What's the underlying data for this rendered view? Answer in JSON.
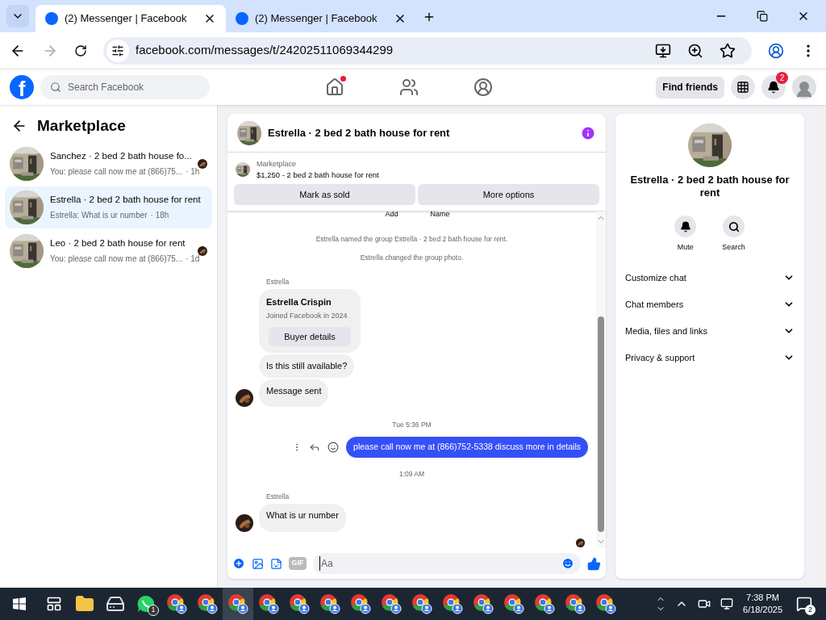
{
  "browser": {
    "tabs": [
      {
        "title": "(2) Messenger | Facebook",
        "selected": true
      },
      {
        "title": "(2) Messenger | Facebook",
        "selected": false
      }
    ],
    "url": "facebook.com/messages/t/24202511069344299"
  },
  "header": {
    "logo": "f",
    "search_placeholder": "Search Facebook",
    "nav": [
      {
        "kind": "home",
        "dot": true
      },
      {
        "kind": "friends",
        "dot": false
      },
      {
        "kind": "groups",
        "dot": false
      }
    ],
    "find_friends": "Find friends",
    "notifications_badge": "2"
  },
  "sidebar": {
    "title": "Marketplace",
    "conversations": [
      {
        "name": "Sanchez · 2 bed 2 bath house fo...",
        "preview": "You: please call now me at (866)75...",
        "time": "· 1h",
        "selected": false,
        "seen": true
      },
      {
        "name": "Estrella · 2 bed 2 bath house for rent",
        "preview": "Estrella: What is ur number",
        "time": "· 18h",
        "selected": true,
        "seen": false
      },
      {
        "name": "Leo · 2 bed 2 bath house for rent",
        "preview": "You: please call now me at (866)75...",
        "time": "· 1d",
        "selected": false,
        "seen": true
      }
    ]
  },
  "chat": {
    "title": "Estrella · 2 bed 2 bath house for rent",
    "listing": {
      "label": "Marketplace",
      "title": "$1,250 - 2 bed 2 bath house for rent"
    },
    "buttons": [
      "Mark as sold",
      "More options"
    ],
    "cut_labels": [
      "Add",
      "Name"
    ],
    "events": [
      {
        "kind": "system",
        "text": "Estrella named the group Estrella · 2 bed 2 bath house for rent."
      },
      {
        "kind": "system",
        "text": "Estrella changed the group photo."
      },
      {
        "kind": "sender",
        "text": "Estrella"
      },
      {
        "kind": "profile",
        "name": "Estrella Crispin",
        "detail": "Joined Facebook in 2024",
        "button": "Buyer details"
      },
      {
        "kind": "incoming",
        "text": "Is this still available?",
        "avatar": false
      },
      {
        "kind": "incoming",
        "text": "Message sent",
        "avatar": true
      },
      {
        "kind": "timestamp",
        "text": "Tue 5:36 PM"
      },
      {
        "kind": "outgoing",
        "text": "please call now me at (866)752-5338 discuss more in details"
      },
      {
        "kind": "timestamp",
        "text": "1:09 AM"
      },
      {
        "kind": "sender",
        "text": "Estrella"
      },
      {
        "kind": "incoming",
        "text": "What is ur number",
        "avatar": true
      },
      {
        "kind": "seen"
      }
    ],
    "composer": {
      "placeholder": "Aa",
      "gif": "GIF"
    }
  },
  "info": {
    "title": "Estrella · 2 bed 2 bath house for rent",
    "actions": [
      {
        "kind": "mute",
        "label": "Mute"
      },
      {
        "kind": "search",
        "label": "Search"
      }
    ],
    "sections": [
      "Customize chat",
      "Chat members",
      "Media, files and links",
      "Privacy & support"
    ]
  },
  "taskbar": {
    "apps": [
      {
        "kind": "taskview",
        "selected": false
      },
      {
        "kind": "folder",
        "selected": false
      },
      {
        "kind": "drive",
        "selected": false
      },
      {
        "kind": "whatsapp",
        "badge": "1",
        "selected": false
      },
      {
        "kind": "chrome",
        "selected": false
      },
      {
        "kind": "chrome",
        "selected": false
      },
      {
        "kind": "chrome",
        "selected": true
      },
      {
        "kind": "chrome",
        "selected": false
      },
      {
        "kind": "chrome",
        "selected": false
      },
      {
        "kind": "chrome",
        "selected": false
      },
      {
        "kind": "chrome",
        "selected": false
      },
      {
        "kind": "chrome",
        "selected": false
      },
      {
        "kind": "chrome",
        "selected": false
      },
      {
        "kind": "chrome",
        "selected": false
      },
      {
        "kind": "chrome",
        "selected": false
      },
      {
        "kind": "chrome",
        "selected": false
      },
      {
        "kind": "chrome",
        "selected": false
      },
      {
        "kind": "chrome",
        "selected": false
      },
      {
        "kind": "chrome",
        "selected": false
      }
    ],
    "time": "7:38 PM",
    "date": "6/18/2025",
    "notifications": "2"
  }
}
